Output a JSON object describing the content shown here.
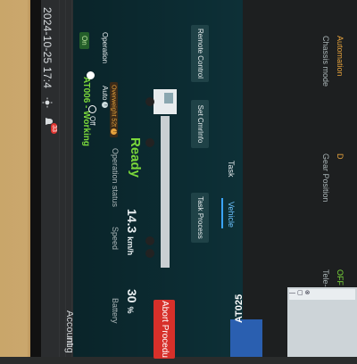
{
  "status_bar": {
    "date": "2024-10-25 17:4",
    "notification_count": "33"
  },
  "menu": {
    "account": "Account",
    "config": "nfig"
  },
  "header": {
    "title": "AT006 - Working",
    "overweight_label": "Overweight 52t",
    "abort_button": "Abort Procedu"
  },
  "operation": {
    "label": "Operation",
    "on_label": "On",
    "auto_label": "Auto",
    "off_label": "Off"
  },
  "status": {
    "operation_status_label": "Operation status",
    "operation_status_value": "Ready",
    "speed_label": "Speed",
    "speed_value": "14.3",
    "speed_unit": "km/h",
    "battery_label": "Battery",
    "battery_value": "30",
    "battery_unit": "%"
  },
  "buttons": {
    "remote_control": "Remote Control",
    "set_cmrinfo": "Set CmrInfo",
    "task_process": "Task Process"
  },
  "tabs": [
    {
      "label": "Task",
      "active": false
    },
    {
      "label": "Vehicle",
      "active": true
    }
  ],
  "vehicle_info": {
    "chassis_mode_label": "Chassis mode",
    "chassis_mode_value": "Automation",
    "gear_position_label": "Gear Position",
    "gear_position_value": "D",
    "estop_label": "Tele-op EStop Button",
    "estop_value": "OFF"
  },
  "map": {
    "vehicle_tag": "AT025"
  },
  "colors": {
    "panel_bg": "#0d3037",
    "ready_green": "#7bd83b",
    "abort_red": "#d7302a",
    "active_tab_blue": "#3aa4ff",
    "warning_orange": "#e6a23c"
  }
}
